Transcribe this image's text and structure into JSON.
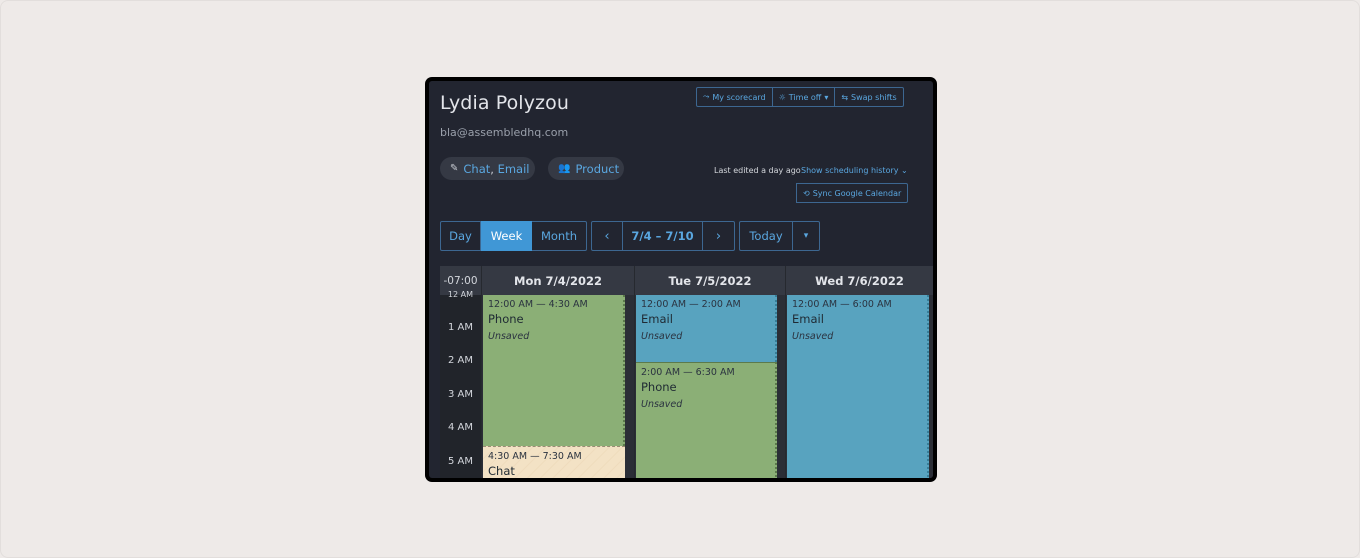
{
  "profile": {
    "name": "Lydia Polyzou",
    "email": "bla@assembledhq.com"
  },
  "actions": {
    "scorecard": "My scorecard",
    "time_off": "Time off",
    "swap_shifts": "Swap shifts",
    "sync_calendar": "Sync Google Calendar"
  },
  "tags": {
    "channels_a": "Chat",
    "channels_sep": ", ",
    "channels_b": "Email",
    "team": "Product"
  },
  "history": {
    "last_edited": "Last edited a day ago",
    "link": "Show scheduling history"
  },
  "toolbar": {
    "views": [
      "Day",
      "Week",
      "Month"
    ],
    "active_view": "Week",
    "prev": "‹",
    "range": "7/4 – 7/10",
    "next": "›",
    "today": "Today",
    "caret": "▾"
  },
  "calendar": {
    "timezone": "-07:00",
    "days": [
      "Mon 7/4/2022",
      "Tue 7/5/2022",
      "Wed 7/6/2022"
    ],
    "hours": [
      "12 AM",
      "1 AM",
      "2 AM",
      "3 AM",
      "4 AM",
      "5 AM"
    ],
    "events": {
      "mon_1": {
        "time": "12:00 AM — 4:30 AM",
        "type": "Phone",
        "status": "Unsaved",
        "color": "#8baf76"
      },
      "mon_2": {
        "time": "4:30 AM — 7:30 AM",
        "type": "Chat",
        "color": "#f3e2c5"
      },
      "tue_1": {
        "time": "12:00 AM — 2:00 AM",
        "type": "Email",
        "status": "Unsaved",
        "color": "#58a3bf"
      },
      "tue_2": {
        "time": "2:00 AM — 6:30 AM",
        "type": "Phone",
        "status": "Unsaved",
        "color": "#8baf76"
      },
      "wed_1": {
        "time": "12:00 AM — 6:00 AM",
        "type": "Email",
        "status": "Unsaved",
        "color": "#58a3bf"
      }
    }
  },
  "colors": {
    "accent": "#4097d6",
    "background": "#222530",
    "outer": "#eeeae8"
  }
}
